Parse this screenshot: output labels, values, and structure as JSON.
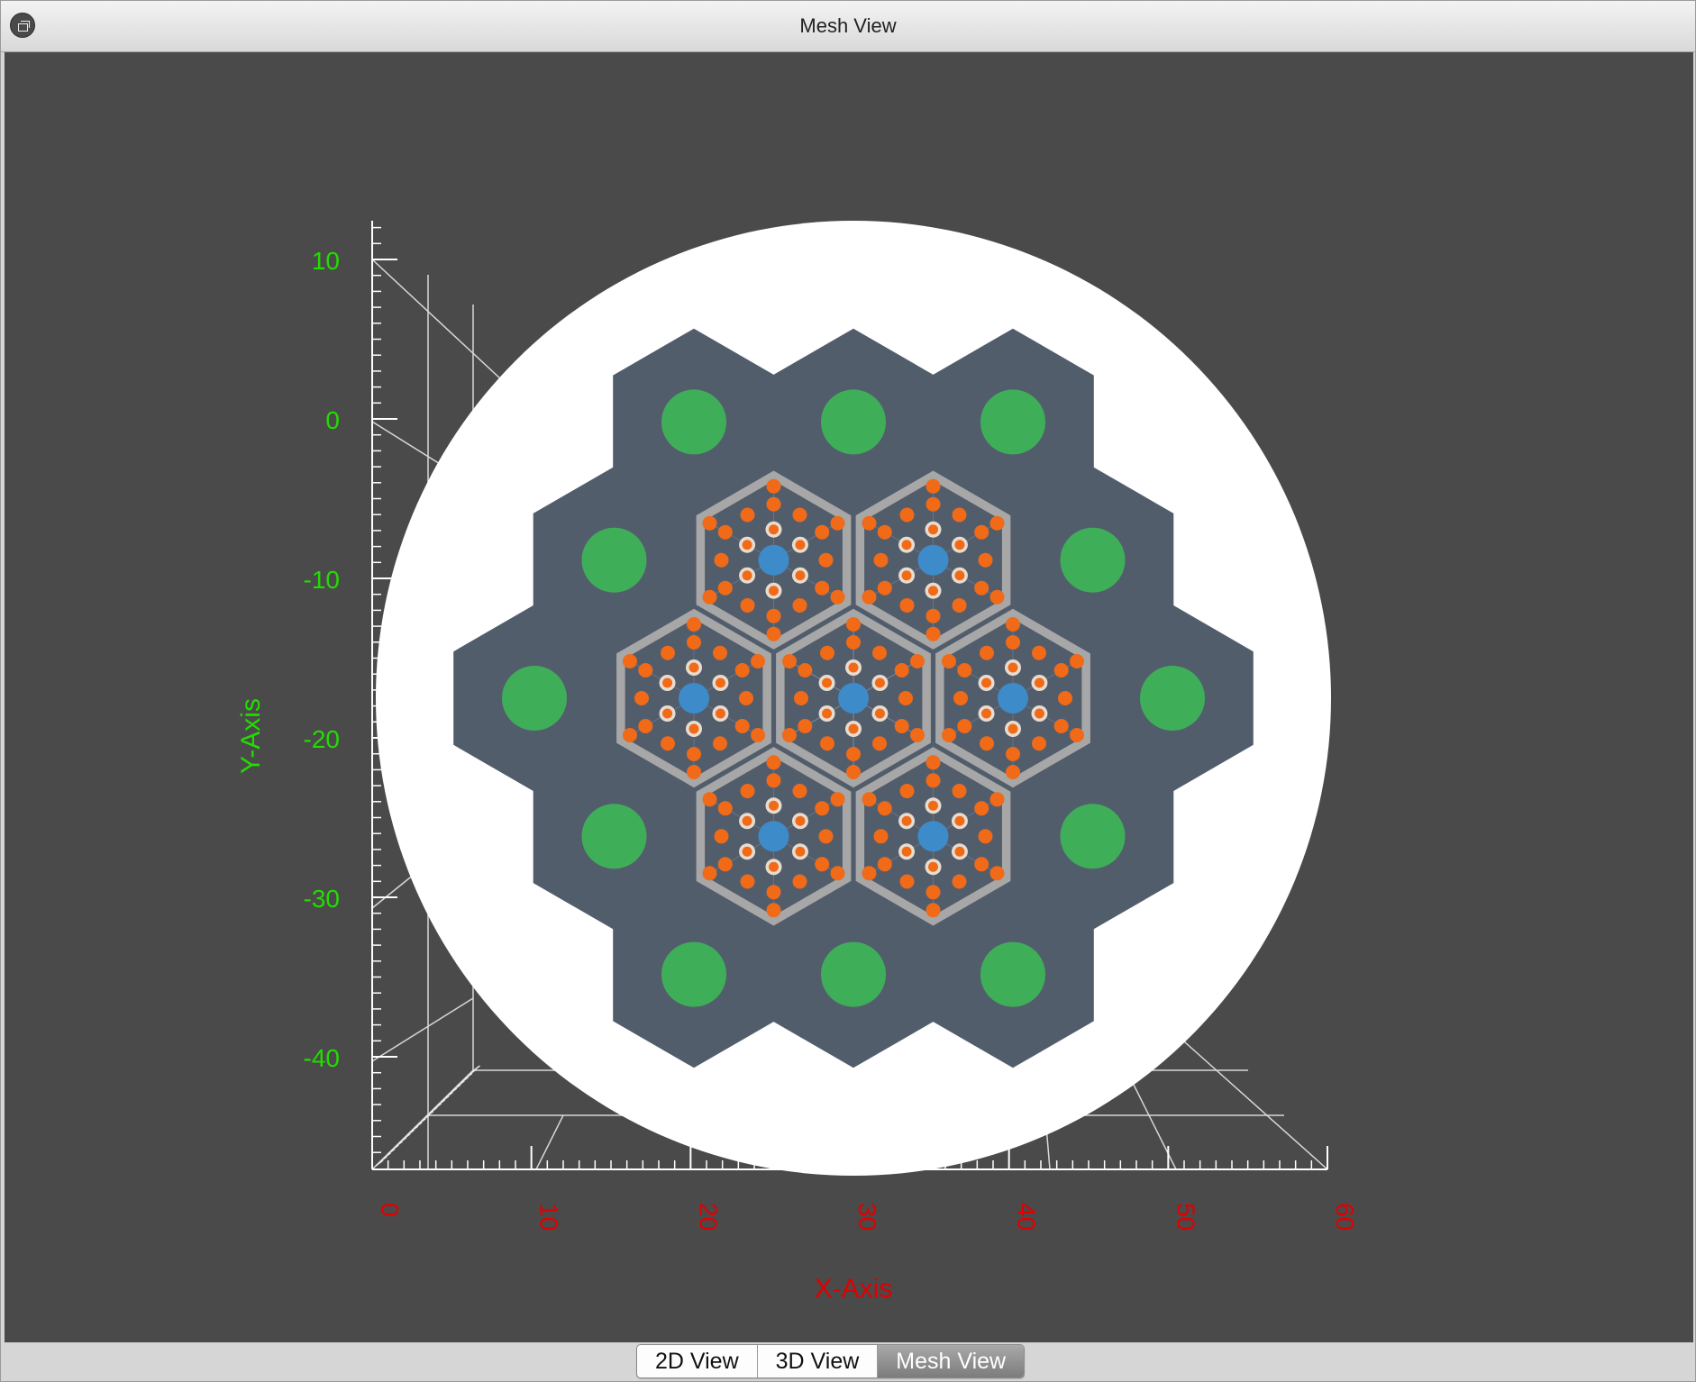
{
  "window": {
    "title": "Mesh View",
    "restore_icon": "restore-window-icon"
  },
  "plot": {
    "x_axis_label": "X-Axis",
    "y_axis_label": "Y-Axis",
    "x_ticks": [
      "0",
      "10",
      "20",
      "30",
      "40",
      "50",
      "60"
    ],
    "y_ticks": [
      "10",
      "0",
      "-10",
      "-20",
      "-30",
      "-40"
    ],
    "x_tick_values": [
      0,
      10,
      20,
      30,
      40,
      50,
      60
    ],
    "y_tick_values": [
      10,
      0,
      -10,
      -20,
      -30,
      -40
    ],
    "x_range": [
      0,
      60
    ],
    "y_range": [
      -47,
      12.5
    ],
    "colors": {
      "background": "#4a4a4a",
      "x_axis_text": "#e00000",
      "y_axis_text": "#22dd00",
      "vessel": "#ffffff",
      "reflector": "#525d6c",
      "control_rod": "#3fae59",
      "assembly_border": "#a7a7a7",
      "center_pin": "#3d8bc9",
      "fuel_pin": "#f06a18"
    }
  },
  "tabs": [
    {
      "label": "2D View",
      "active": false
    },
    {
      "label": "3D View",
      "active": false
    },
    {
      "label": "Mesh View",
      "active": true
    }
  ]
}
